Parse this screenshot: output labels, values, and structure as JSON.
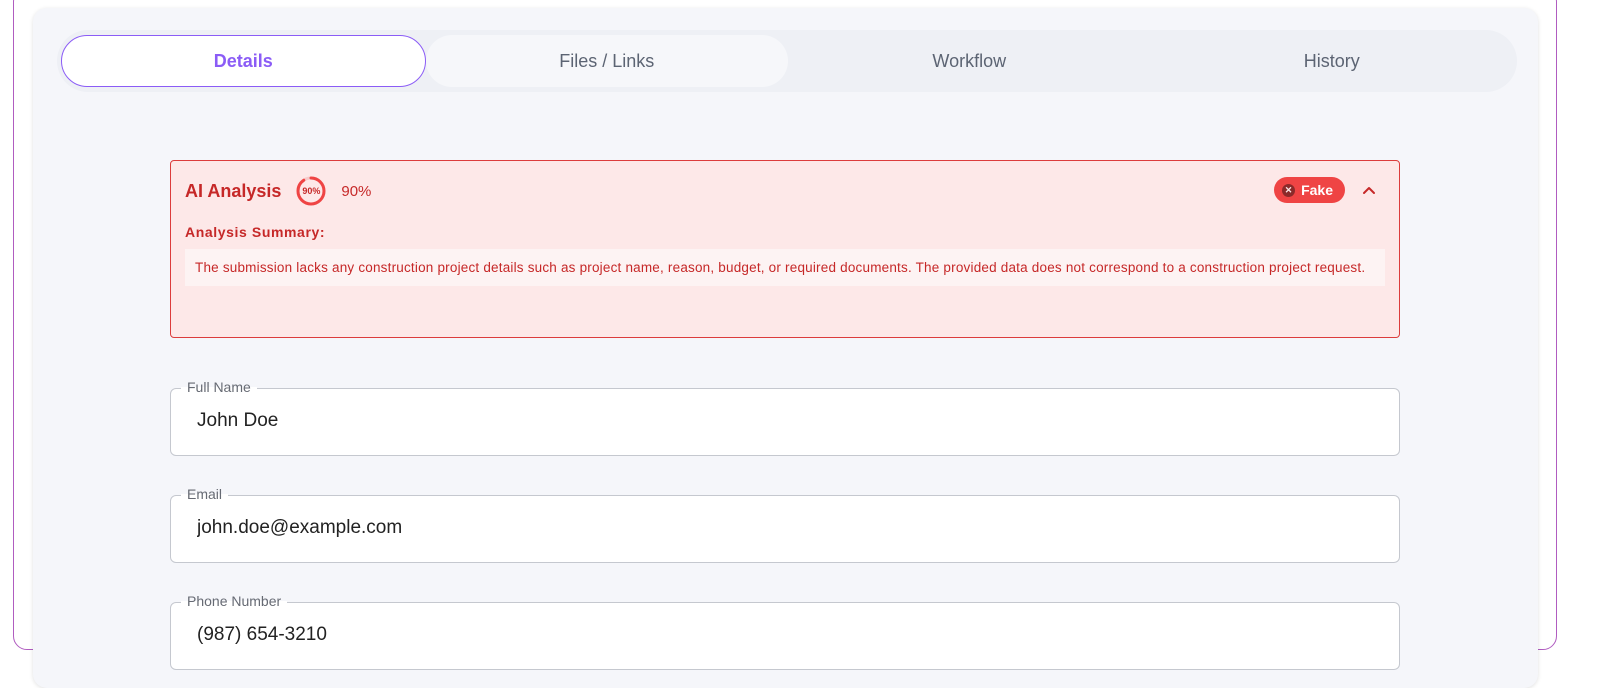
{
  "tabs": [
    {
      "label": "Details"
    },
    {
      "label": "Files / Links"
    },
    {
      "label": "Workflow"
    },
    {
      "label": "History"
    }
  ],
  "ai_analysis": {
    "title": "AI Analysis",
    "ring_label": "90%",
    "confidence_text": "90%",
    "confidence": 0.9,
    "badge": "Fake",
    "summary_label": "Analysis Summary:",
    "summary": "The submission lacks any construction project details such as project name, reason, budget, or required documents. The provided data does not correspond to a construction project request."
  },
  "fields": [
    {
      "label": "Full Name",
      "value": "John Doe"
    },
    {
      "label": "Email",
      "value": "john.doe@example.com"
    },
    {
      "label": "Phone Number",
      "value": "(987) 654-3210"
    }
  ],
  "colors": {
    "accent": "#8b5cf6",
    "danger": "#ef4444",
    "danger_text": "#c62828",
    "danger_bg": "#fde8e8"
  },
  "icons": {
    "badge_icon": "x-circle-icon",
    "collapse_icon": "chevron-up-icon"
  }
}
